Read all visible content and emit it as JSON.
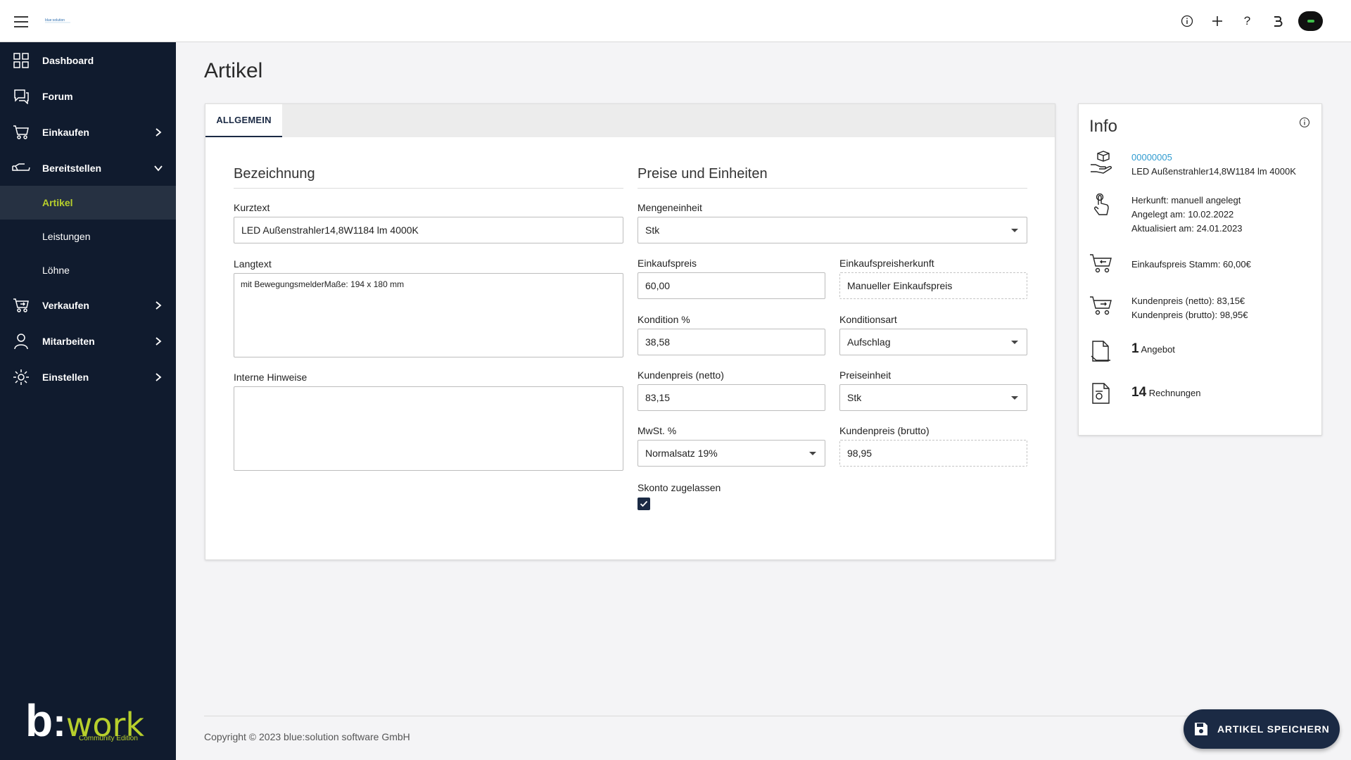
{
  "topbar": {
    "logo_text": "blue:solution GmbH",
    "actions": [
      {
        "icon": "info-circle-icon",
        "glyph": "ⓘ"
      },
      {
        "icon": "plus-icon",
        "glyph": "+"
      },
      {
        "icon": "help-icon",
        "glyph": "?"
      },
      {
        "icon": "b-logo-icon",
        "glyph": "ʙ"
      }
    ]
  },
  "sidebar": {
    "items": [
      {
        "label": "Dashboard",
        "icon": "dashboard-icon"
      },
      {
        "label": "Forum",
        "icon": "forum-icon"
      },
      {
        "label": "Einkaufen",
        "icon": "cart-icon",
        "expandable": true
      },
      {
        "label": "Bereitstellen",
        "icon": "tray-icon",
        "expanded": true
      },
      {
        "label": "Verkaufen",
        "icon": "cart-out-icon",
        "expandable": true
      },
      {
        "label": "Mitarbeiten",
        "icon": "person-icon",
        "expandable": true
      },
      {
        "label": "Einstellen",
        "icon": "gear-icon",
        "expandable": true
      }
    ],
    "subitems": [
      {
        "label": "Artikel",
        "active": true
      },
      {
        "label": "Leistungen"
      },
      {
        "label": "Löhne"
      }
    ],
    "logo": {
      "b": "b",
      "colon": ":",
      "work": "work",
      "edition": "Community Edition"
    }
  },
  "page": {
    "title": "Artikel"
  },
  "tabs": [
    {
      "label": "ALLGEMEIN",
      "active": true
    }
  ],
  "bezeichnung": {
    "title": "Bezeichnung",
    "kurztext_label": "Kurztext",
    "kurztext_value": "LED Außenstrahler14,8W1184 lm 4000K",
    "langtext_label": "Langtext",
    "langtext_value": "mit BewegungsmelderMaße: 194 x 180 mm",
    "hinweise_label": "Interne Hinweise",
    "hinweise_value": ""
  },
  "preise": {
    "title": "Preise und Einheiten",
    "mengeneinheit_label": "Mengeneinheit",
    "mengeneinheit_value": "Stk",
    "einkaufspreis_label": "Einkaufspreis",
    "einkaufspreis_value": "60,00",
    "einkaufspreisherkunft_label": "Einkaufspreisherkunft",
    "einkaufspreisherkunft_value": "Manueller Einkaufspreis",
    "kondition_label": "Kondition %",
    "kondition_value": "38,58",
    "konditionsart_label": "Konditionsart",
    "konditionsart_value": "Aufschlag",
    "kundenpreis_netto_label": "Kundenpreis (netto)",
    "kundenpreis_netto_value": "83,15",
    "preiseinheit_label": "Preiseinheit",
    "preiseinheit_value": "Stk",
    "mwst_label": "MwSt. %",
    "mwst_value": "Normalsatz 19%",
    "kundenpreis_brutto_label": "Kundenpreis (brutto)",
    "kundenpreis_brutto_value": "98,95",
    "skonto_label": "Skonto zugelassen",
    "skonto_checked": true
  },
  "info": {
    "title": "Info",
    "article_number": "00000005",
    "article_name": "LED Außenstrahler14,8W1184 lm 4000K",
    "herkunft": "Herkunft: manuell angelegt",
    "angelegt": "Angelegt am: 10.02.2022",
    "aktualisiert": "Aktualisiert am: 24.01.2023",
    "einkaufspreis_stamm": "Einkaufspreis Stamm: 60,00€",
    "kundenpreis_netto": "Kundenpreis (netto): 83,15€",
    "kundenpreis_brutto": "Kundenpreis (brutto): 98,95€",
    "angebot_count": "1",
    "angebot_label": "Angebot",
    "rechnungen_count": "14",
    "rechnungen_label": "Rechnungen"
  },
  "footer": {
    "copyright": "Copyright © 2023 blue:solution software GmbH",
    "save_label": "ARTIKEL SPEICHERN"
  },
  "colors": {
    "sidebar_bg": "#101b2e",
    "accent": "#b7cf2c",
    "primary": "#1b2a44",
    "link": "#2f9bd0"
  }
}
